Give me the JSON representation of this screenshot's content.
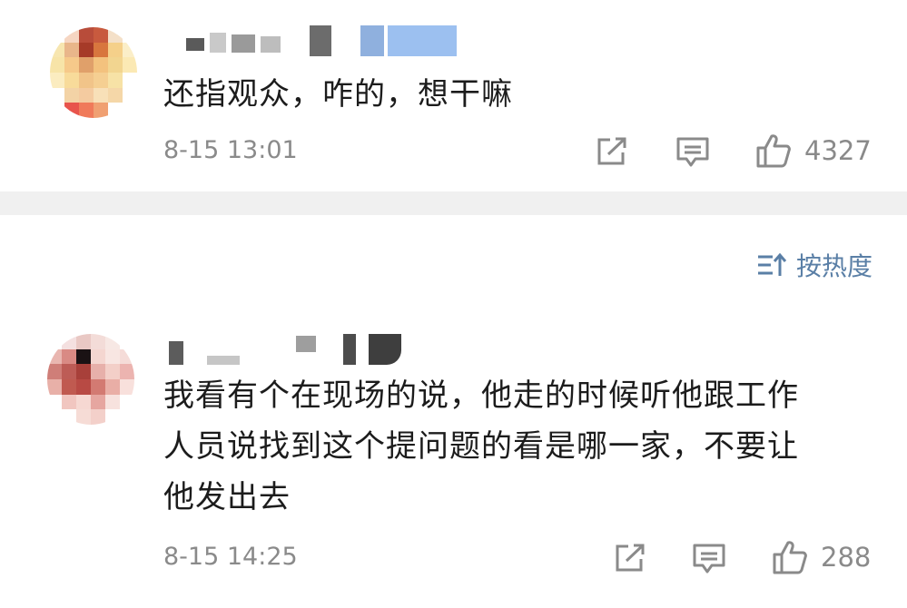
{
  "comments": [
    {
      "text": "还指观众，咋的，想干嘛",
      "time": "8-15 13:01",
      "like_count": "4327",
      "avatar_colors": [
        "#ffffff",
        "#f6d6c2",
        "#b84c3a",
        "#c85a3e",
        "#f4e0c8",
        "#ffffff",
        "#f7e6b0",
        "#e9b68a",
        "#a63a28",
        "#d8763e",
        "#f5d08a",
        "#fbeec8",
        "#f7e4a8",
        "#f6c98a",
        "#e0a06a",
        "#f3c27e",
        "#f2d590",
        "#fbe9b4",
        "#fbecc0",
        "#f8db9a",
        "#f1c489",
        "#f5cf92",
        "#f7e2a6",
        "#ffffff",
        "#ffffff",
        "#f3d3a6",
        "#f4cba0",
        "#f8e0b8",
        "#f5d7a8",
        "#ffffff",
        "#ffffff",
        "#e8544c",
        "#f07a5a",
        "#f0a072",
        "#ffffff",
        "#ffffff"
      ]
    },
    {
      "text": "我看有个在现场的说，他走的时候听他跟工作\n人员说找到这个提问题的看是哪一家，不要让\n他发出去",
      "time": "8-15 14:25",
      "like_count": "288",
      "avatar_colors": [
        "#ffffff",
        "#f4e0e0",
        "#e9c8c4",
        "#f3dcd8",
        "#f7e8e4",
        "#ffffff",
        "#e9b6b0",
        "#d98a84",
        "#1a1214",
        "#f4d6d0",
        "#f8e6e2",
        "#f5dcd8",
        "#cf7e78",
        "#bd5c56",
        "#a8403a",
        "#e7b0aa",
        "#f3cfc8",
        "#ecb4b0",
        "#e8b0a8",
        "#c05a50",
        "#b84a44",
        "#d37a72",
        "#e9aea6",
        "#f8e0dc",
        "#ffffff",
        "#f1c6c0",
        "#f6d8d2",
        "#e6a6a0",
        "#f7e2de",
        "#ffffff",
        "#ffffff",
        "#ffffff",
        "#f6dcd6",
        "#f3d0ca",
        "#ffffff",
        "#ffffff"
      ]
    }
  ],
  "sort": {
    "label": "按热度"
  },
  "icons": {
    "share": "share-icon",
    "comment": "comment-icon",
    "like": "thumbs-up-icon",
    "sort": "sort-icon"
  },
  "colors": {
    "accent": "#5a7fa6",
    "muted": "#8a8a8a",
    "divider": "#f0f0f0"
  }
}
